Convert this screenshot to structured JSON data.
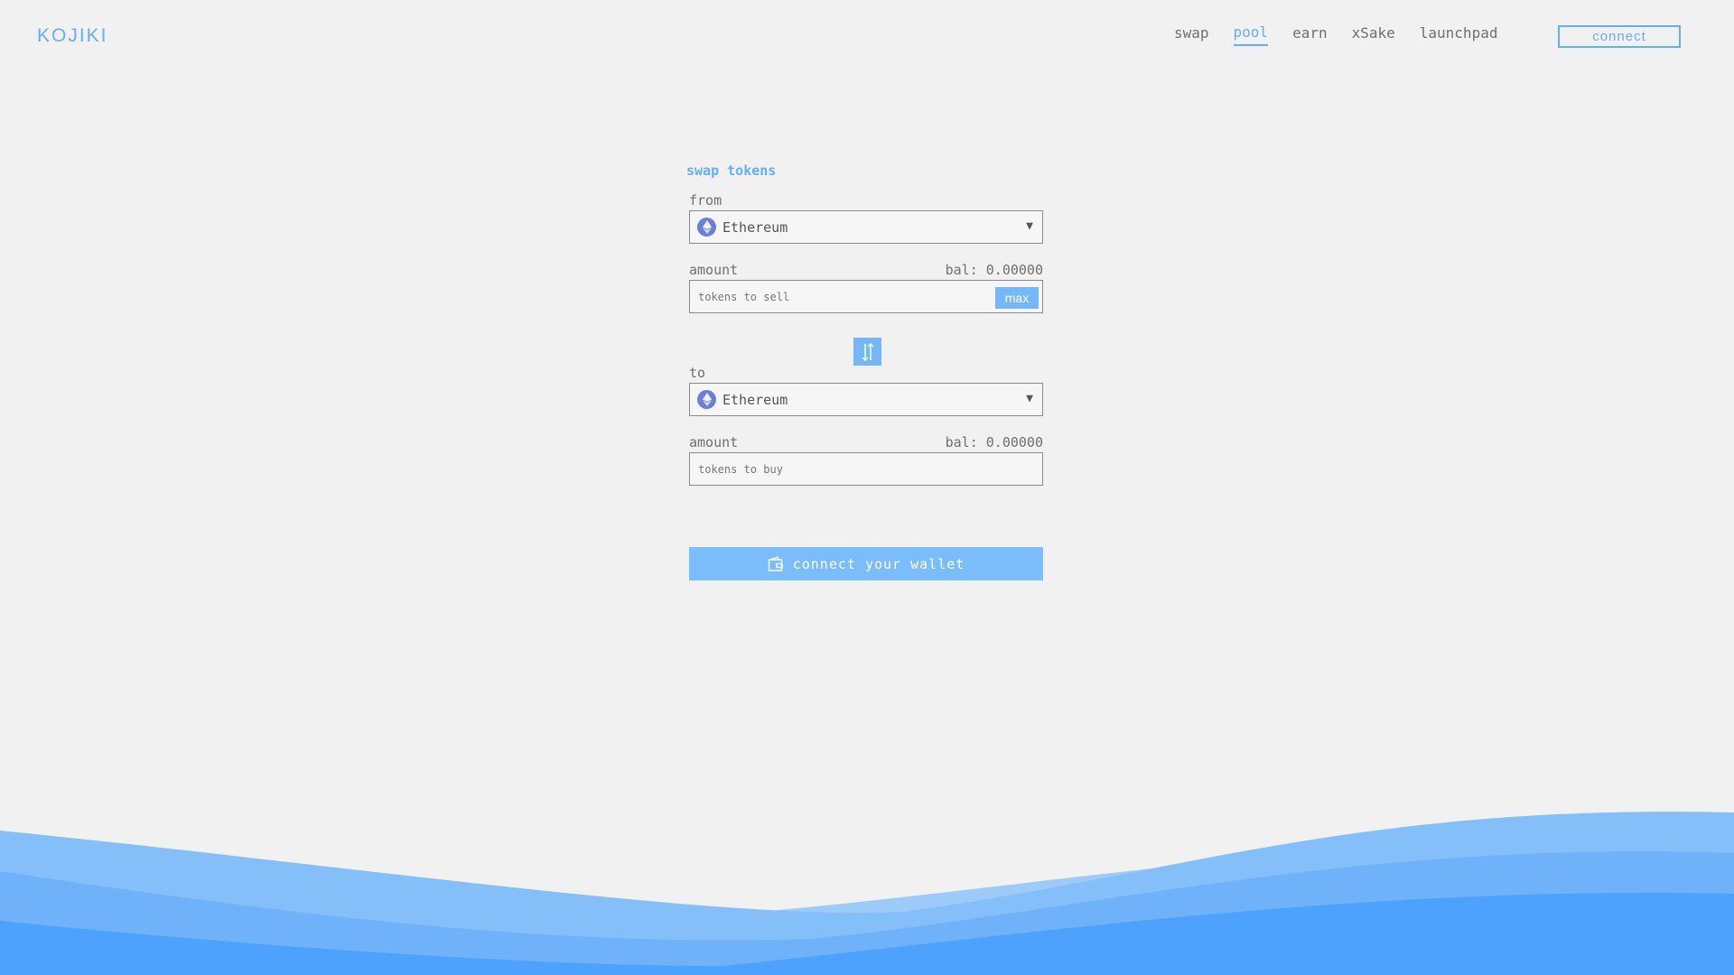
{
  "header": {
    "logo": "KOJIKI",
    "nav": [
      "swap",
      "pool",
      "earn",
      "xSake",
      "launchpad"
    ],
    "active_nav": "pool",
    "connect_label": "connect"
  },
  "swap": {
    "title": "swap tokens",
    "from_label": "from",
    "from_token": "Ethereum",
    "from_amount_label": "amount",
    "from_balance": "bal: 0.00000",
    "from_placeholder": "tokens to sell",
    "max_label": "max",
    "to_label": "to",
    "to_token": "Ethereum",
    "to_amount_label": "amount",
    "to_balance": "bal: 0.00000",
    "to_placeholder": "tokens to buy",
    "wallet_button": "connect your wallet"
  },
  "colors": {
    "accent": "#64aef7",
    "button": "#7bbcfa",
    "background": "#f1f1f1"
  }
}
